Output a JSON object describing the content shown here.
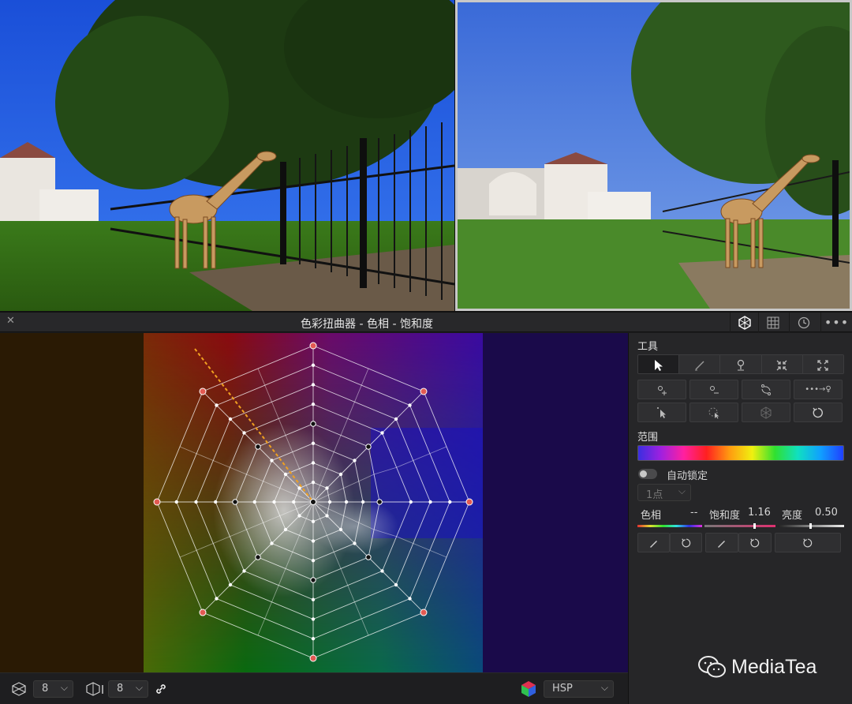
{
  "panel_title": "色彩扭曲器 - 色相 - 饱和度",
  "tools_label": "工具",
  "range_label": "范围",
  "auto_lock_label": "自动锁定",
  "points_select": "1点",
  "hue_label": "色相",
  "hue_value": "--",
  "saturation_label": "饱和度",
  "saturation_value": "1.16",
  "luminance_label": "亮度",
  "luminance_value": "0.50",
  "bottom": {
    "hue_resolution": "8",
    "sat_resolution": "8",
    "colorspace": "HSP"
  },
  "watermark": "MediaTea",
  "colors": {
    "accent_points": "#e25a52",
    "guide_line": "#f0a020"
  }
}
